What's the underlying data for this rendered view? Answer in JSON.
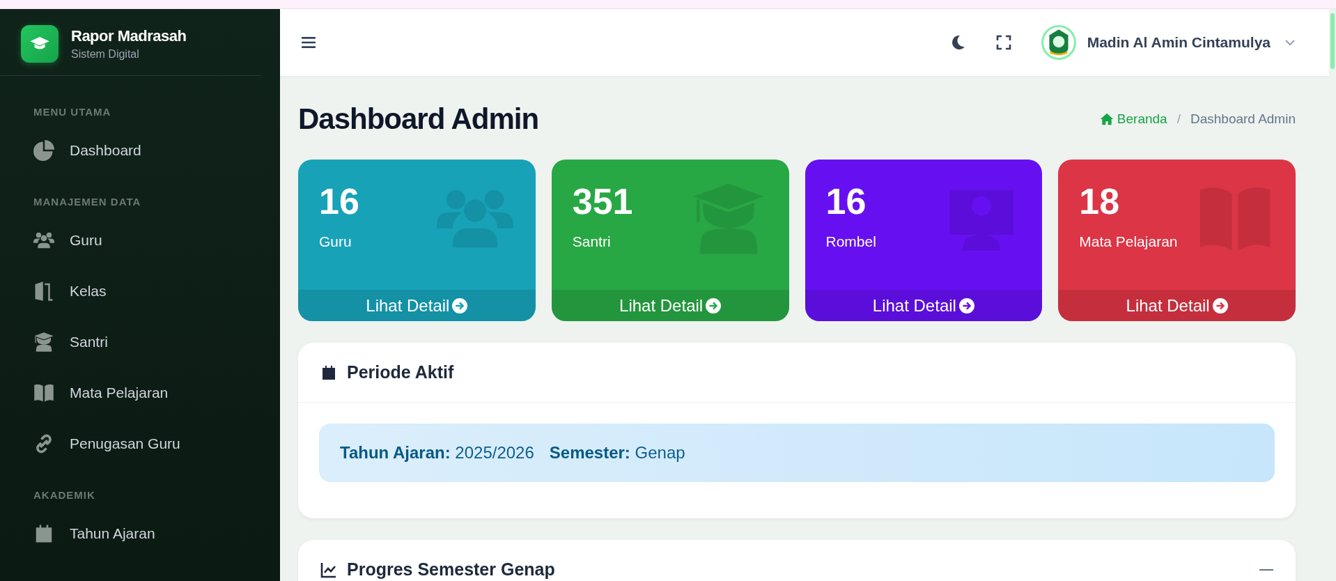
{
  "sidebar": {
    "brand": {
      "title": "Rapor Madrasah",
      "subtitle": "Sistem Digital"
    },
    "sections": [
      {
        "heading": "MENU UTAMA",
        "items": [
          {
            "label": "Dashboard",
            "kind": "pie"
          }
        ]
      },
      {
        "heading": "MANAJEMEN DATA",
        "items": [
          {
            "label": "Guru",
            "kind": "users"
          },
          {
            "label": "Kelas",
            "kind": "door"
          },
          {
            "label": "Santri",
            "kind": "graduate"
          },
          {
            "label": "Mata Pelajaran",
            "kind": "book"
          },
          {
            "label": "Penugasan Guru",
            "kind": "link"
          }
        ]
      },
      {
        "heading": "AKADEMIK",
        "items": [
          {
            "label": "Tahun Ajaran",
            "kind": "calendar"
          }
        ]
      }
    ]
  },
  "topbar": {
    "user": "Madin Al Amin Cintamulya"
  },
  "page": {
    "title": "Dashboard Admin",
    "breadcrumb_separator": "/",
    "breadcrumb": [
      {
        "label": "Beranda",
        "kind": "home"
      },
      {
        "label": "Dashboard Admin",
        "kind": "current"
      }
    ]
  },
  "stats": [
    {
      "value": "16",
      "label": "Guru",
      "link": "Lihat Detail",
      "color": "#17a2b8",
      "kind": "users"
    },
    {
      "value": "351",
      "label": "Santri",
      "link": "Lihat Detail",
      "color": "#28a745",
      "kind": "graduate"
    },
    {
      "value": "16",
      "label": "Rombel",
      "link": "Lihat Detail",
      "color": "#6610f2",
      "kind": "board"
    },
    {
      "value": "18",
      "label": "Mata Pelajaran",
      "link": "Lihat Detail",
      "color": "#dc3545",
      "kind": "book"
    }
  ],
  "periode": {
    "title": "Periode Aktif",
    "fields": [
      {
        "label": "Tahun Ajaran:",
        "value": "2025/2026"
      },
      {
        "label": "Semester:",
        "value": "Genap"
      }
    ]
  },
  "progress": {
    "title": "Progres Semester Genap"
  }
}
